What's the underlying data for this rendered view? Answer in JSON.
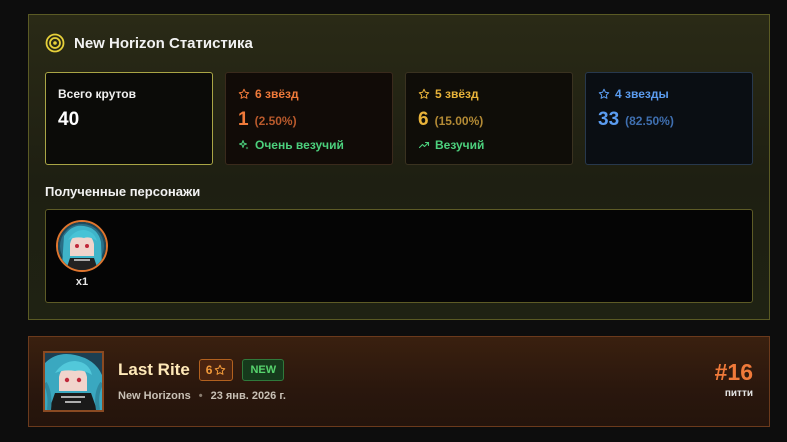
{
  "stats": {
    "title": "New Horizon Статистика",
    "title_icon": "target-icon",
    "cards": {
      "total": {
        "label": "Всего крутов",
        "value": "40"
      },
      "six_star": {
        "label": "6 звёзд",
        "value": "1",
        "percent": "(2.50%)",
        "luck": "Очень везучий",
        "icon": "star-outline-icon",
        "luck_icon": "sparkles-icon",
        "color": "#f07a3a"
      },
      "five_star": {
        "label": "5 звёзд",
        "value": "6",
        "percent": "(15.00%)",
        "luck": "Везучий",
        "icon": "star-outline-icon",
        "luck_icon": "trending-up-icon",
        "color": "#e8b33a"
      },
      "four_star": {
        "label": "4 звезды",
        "value": "33",
        "percent": "(82.50%)",
        "icon": "star-outline-icon",
        "color": "#5b9cf0"
      }
    },
    "characters_section_title": "Полученные персонажи",
    "characters": [
      {
        "count": "x1"
      }
    ]
  },
  "pull": {
    "name": "Last Rite",
    "rarity": "6",
    "new_label": "NEW",
    "banner": "New Horizons",
    "separator": "•",
    "date": "23 янв. 2026 г.",
    "pity_number": "#16",
    "pity_label": "питти"
  }
}
